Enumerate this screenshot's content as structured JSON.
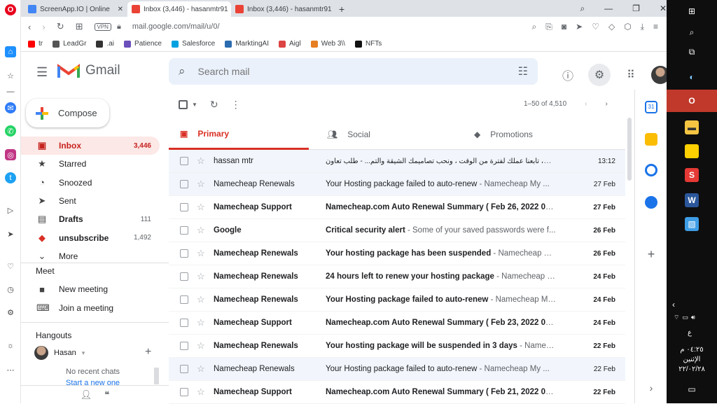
{
  "browser": {
    "tabs": [
      {
        "label": "ScreenApp.IO | Online",
        "fav": "#4285f4"
      },
      {
        "label": "Inbox (3,446) - hasanmtr91",
        "fav": "#ea4335"
      },
      {
        "label": "Inbox (3,446) - hasanmtr91",
        "fav": "#ea4335"
      }
    ],
    "url": "mail.google.com/mail/u/0/",
    "vpn": "VPN",
    "bookmarks": [
      {
        "label": "tr",
        "color": "#ff0000"
      },
      {
        "label": "LeadGr",
        "color": "#555"
      },
      {
        "label": ".ai",
        "color": "#333"
      },
      {
        "label": "Patience",
        "color": "#6b4fbb"
      },
      {
        "label": "Salesforce",
        "color": "#00a1e0"
      },
      {
        "label": "MarktingAI",
        "color": "#2b6cb0"
      },
      {
        "label": "Aigl",
        "color": "#d44"
      },
      {
        "label": "Web 3\\\\",
        "color": "#e67e22"
      },
      {
        "label": "NFTs",
        "color": "#111"
      }
    ]
  },
  "gmail": {
    "logo": "Gmail",
    "search_placeholder": "Search mail",
    "compose": "Compose",
    "nav": [
      {
        "label": "Inbox",
        "icon": "inbox-icon",
        "glyph": "▣",
        "count": "3,446",
        "active": true,
        "bold": true
      },
      {
        "label": "Starred",
        "icon": "star-icon",
        "glyph": "★",
        "count": "",
        "active": false,
        "bold": false
      },
      {
        "label": "Snoozed",
        "icon": "clock-icon",
        "glyph": "◔",
        "count": "",
        "active": false,
        "bold": false
      },
      {
        "label": "Sent",
        "icon": "send-icon",
        "glyph": "➤",
        "count": "",
        "active": false,
        "bold": false
      },
      {
        "label": "Drafts",
        "icon": "draft-icon",
        "glyph": "▤",
        "count": "111",
        "active": false,
        "bold": true
      },
      {
        "label": "unsubscribe",
        "icon": "label-icon",
        "glyph": "◆",
        "count": "1,492",
        "active": false,
        "bold": true
      },
      {
        "label": "More",
        "icon": "chevron-down-icon",
        "glyph": "⌄",
        "count": "",
        "active": false,
        "bold": false
      }
    ],
    "meet": {
      "title": "Meet",
      "new_meeting": "New meeting",
      "join": "Join a meeting"
    },
    "hangouts": {
      "title": "Hangouts",
      "user": "Hasan",
      "no_chats": "No recent chats",
      "start": "Start a new one"
    },
    "pager": "1–50 of 4,510",
    "categories": [
      "Primary",
      "Social",
      "Promotions"
    ],
    "emails": [
      {
        "from": "hassan mtr",
        "subject": "",
        "snippet": "مرحبا حسن، تابعنا عملك لفترة من الوقت ، ونحب تصاميمك الشيقة والتم... - طلب تعاون-",
        "date": "13:12",
        "unread": false
      },
      {
        "from": "Namecheap Renewals",
        "subject": "Your Hosting package failed to auto-renew",
        "snippet": " - Namecheap My ...",
        "date": "27 Feb",
        "unread": false
      },
      {
        "from": "Namecheap Support",
        "subject": "Namecheap.com Auto Renewal Summary ( Feb 26, 2022 07:...",
        "snippet": "",
        "date": "27 Feb",
        "unread": true
      },
      {
        "from": "Google",
        "subject": "Critical security alert",
        "snippet": " - Some of your saved passwords were f...",
        "date": "26 Feb",
        "unread": true
      },
      {
        "from": "Namecheap Renewals",
        "subject": "Your hosting package has been suspended",
        "snippet": " - Namecheap My ...",
        "date": "26 Feb",
        "unread": true
      },
      {
        "from": "Namecheap Renewals",
        "subject": "24 hours left to renew your hosting package",
        "snippet": " - Namecheap M...",
        "date": "24 Feb",
        "unread": true
      },
      {
        "from": "Namecheap Renewals",
        "subject": "Your Hosting package failed to auto-renew",
        "snippet": " - Namecheap My ...",
        "date": "24 Feb",
        "unread": true
      },
      {
        "from": "Namecheap Support",
        "subject": "Namecheap.com Auto Renewal Summary ( Feb 23, 2022 07:...",
        "snippet": "",
        "date": "24 Feb",
        "unread": true
      },
      {
        "from": "Namecheap Renewals",
        "subject": "Your hosting package will be suspended in 3 days",
        "snippet": " - Nameche...",
        "date": "22 Feb",
        "unread": true
      },
      {
        "from": "Namecheap Renewals",
        "subject": "Your Hosting package failed to auto-renew",
        "snippet": " - Namecheap My ...",
        "date": "22 Feb",
        "unread": false
      },
      {
        "from": "Namecheap Support",
        "subject": "Namecheap.com Auto Renewal Summary ( Feb 21, 2022 07:...",
        "snippet": "",
        "date": "22 Feb",
        "unread": true
      }
    ]
  },
  "taskbar": {
    "lang": "ع",
    "time": "٠٤:٢٥ م",
    "day": "الإثنين",
    "date": "٢٢/٠٢/٢٨"
  },
  "colors": {
    "accent": "#d93025",
    "search_bg": "#eaf1fb",
    "inbox_active_bg": "#fce8e6"
  }
}
